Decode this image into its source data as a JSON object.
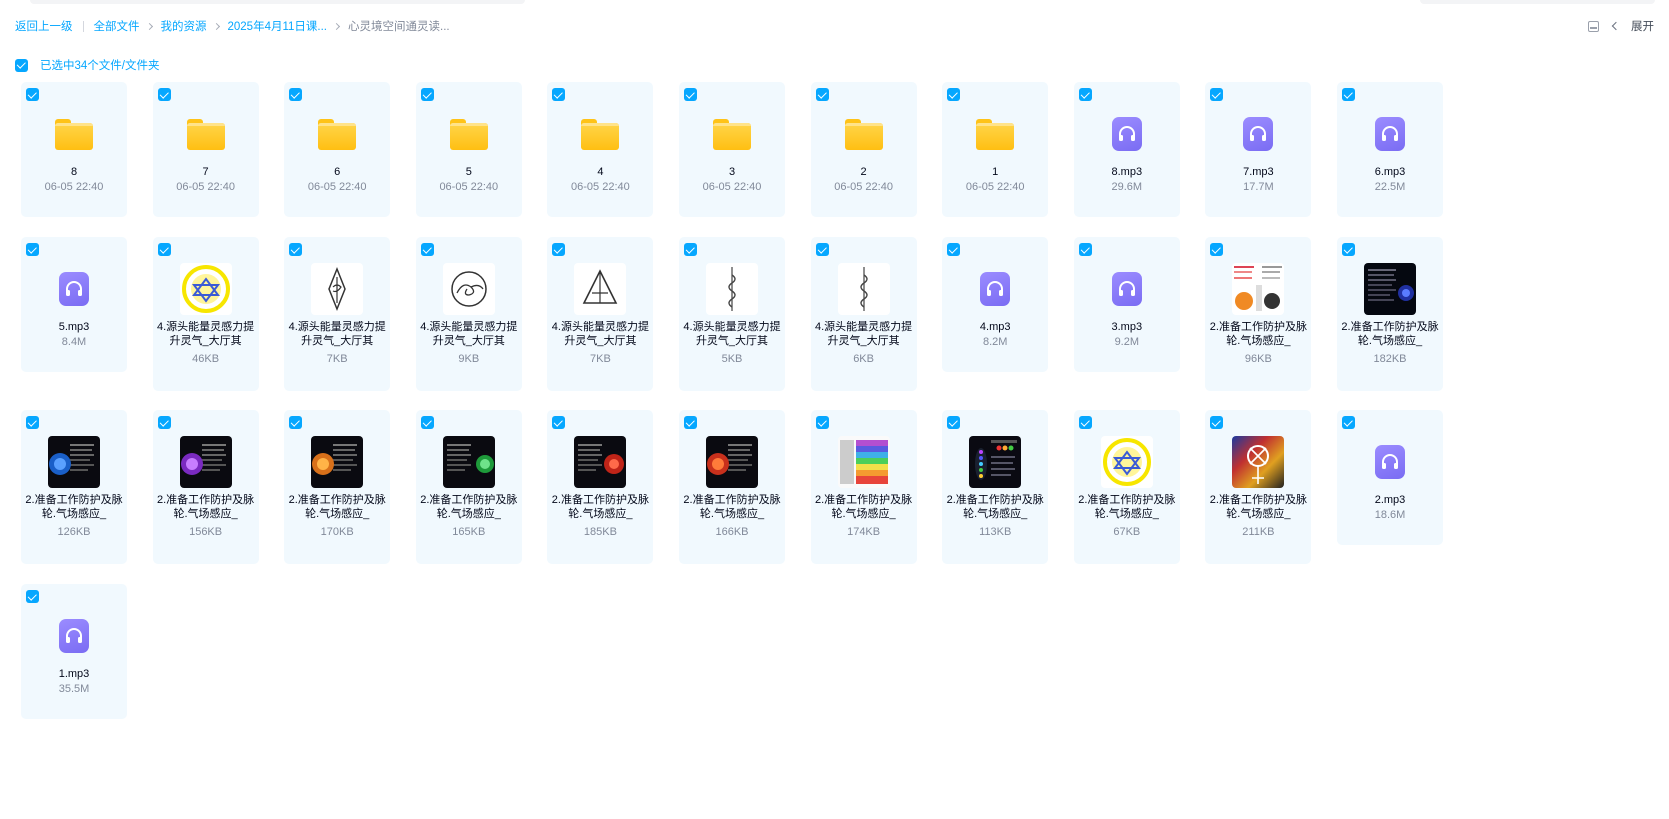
{
  "breadcrumb": {
    "back": "返回上一级",
    "items": [
      "全部文件",
      "我的资源",
      "2025年4月11日课...",
      "心灵境空间通灵读..."
    ]
  },
  "toolbar": {
    "expand": "展开",
    "list_icon": "list-view-icon"
  },
  "selection": {
    "label": "已选中34个文件/文件夹",
    "checked": true
  },
  "colors": {
    "accent": "#06a7ff",
    "card_bg": "#f1f9fe",
    "folder": "#ffc318",
    "audio": "#8577f8"
  },
  "files": [
    {
      "type": "folder",
      "name": "8",
      "meta": "06-05 22:40"
    },
    {
      "type": "folder",
      "name": "7",
      "meta": "06-05 22:40"
    },
    {
      "type": "folder",
      "name": "6",
      "meta": "06-05 22:40"
    },
    {
      "type": "folder",
      "name": "5",
      "meta": "06-05 22:40"
    },
    {
      "type": "folder",
      "name": "4",
      "meta": "06-05 22:40"
    },
    {
      "type": "folder",
      "name": "3",
      "meta": "06-05 22:40"
    },
    {
      "type": "folder",
      "name": "2",
      "meta": "06-05 22:40"
    },
    {
      "type": "folder",
      "name": "1",
      "meta": "06-05 22:40"
    },
    {
      "type": "audio",
      "name": "8.mp3",
      "meta": "29.6M"
    },
    {
      "type": "audio",
      "name": "7.mp3",
      "meta": "17.7M"
    },
    {
      "type": "audio",
      "name": "6.mp3",
      "meta": "22.5M"
    },
    {
      "type": "audio",
      "name": "5.mp3",
      "meta": "8.4M"
    },
    {
      "type": "image",
      "thumb": "yellow-symbol",
      "name": "4.源头能量灵感力提升灵气_大厅其",
      "meta": "46KB"
    },
    {
      "type": "image",
      "thumb": "diamond-symbol",
      "name": "4.源头能量灵感力提升灵气_大厅其",
      "meta": "7KB"
    },
    {
      "type": "image",
      "thumb": "spiral-symbol",
      "name": "4.源头能量灵感力提升灵气_大厅其",
      "meta": "9KB"
    },
    {
      "type": "image",
      "thumb": "triangle-symbol",
      "name": "4.源头能量灵感力提升灵气_大厅其",
      "meta": "7KB"
    },
    {
      "type": "image",
      "thumb": "wave-symbol",
      "name": "4.源头能量灵感力提升灵气_大厅其",
      "meta": "5KB"
    },
    {
      "type": "image",
      "thumb": "wave-symbol",
      "name": "4.源头能量灵感力提升灵气_大厅其",
      "meta": "6KB"
    },
    {
      "type": "audio",
      "name": "4.mp3",
      "meta": "8.2M"
    },
    {
      "type": "audio",
      "name": "3.mp3",
      "meta": "9.2M"
    },
    {
      "type": "image",
      "thumb": "collage",
      "name": "2.准备工作防护及脉轮.气场感应_",
      "meta": "96KB"
    },
    {
      "type": "image",
      "thumb": "dark-blue-chart",
      "name": "2.准备工作防护及脉轮.气场感应_",
      "meta": "182KB"
    },
    {
      "type": "image",
      "thumb": "dark-blue-mandala",
      "name": "2.准备工作防护及脉轮.气场感应_",
      "meta": "126KB"
    },
    {
      "type": "image",
      "thumb": "dark-purple-mandala",
      "name": "2.准备工作防护及脉轮.气场感应_",
      "meta": "156KB"
    },
    {
      "type": "image",
      "thumb": "dark-orange-mandala",
      "name": "2.准备工作防护及脉轮.气场感应_",
      "meta": "170KB"
    },
    {
      "type": "image",
      "thumb": "dark-green-mandala",
      "name": "2.准备工作防护及脉轮.气场感应_",
      "meta": "165KB"
    },
    {
      "type": "image",
      "thumb": "dark-red-mandala",
      "name": "2.准备工作防护及脉轮.气场感应_",
      "meta": "185KB"
    },
    {
      "type": "image",
      "thumb": "dark-red-left",
      "name": "2.准备工作防护及脉轮.气场感应_",
      "meta": "166KB"
    },
    {
      "type": "image",
      "thumb": "chakra-table",
      "name": "2.准备工作防护及脉轮.气场感应_",
      "meta": "174KB"
    },
    {
      "type": "image",
      "thumb": "dark-chakra-body",
      "name": "2.准备工作防护及脉轮.气场感应_",
      "meta": "113KB"
    },
    {
      "type": "image",
      "thumb": "yellow-symbol",
      "name": "2.准备工作防护及脉轮.气场感应_",
      "meta": "67KB"
    },
    {
      "type": "image",
      "thumb": "dark-rainbow",
      "name": "2.准备工作防护及脉轮.气场感应_",
      "meta": "211KB"
    },
    {
      "type": "audio",
      "name": "2.mp3",
      "meta": "18.6M"
    },
    {
      "type": "audio",
      "name": "1.mp3",
      "meta": "35.5M"
    }
  ]
}
